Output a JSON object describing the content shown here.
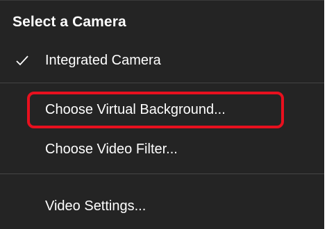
{
  "menu": {
    "header": "Select a Camera",
    "cameras": [
      {
        "label": "Integrated Camera",
        "selected": true
      }
    ],
    "actions": [
      {
        "label": "Choose Virtual Background..."
      },
      {
        "label": "Choose Video Filter..."
      }
    ],
    "settings": [
      {
        "label": "Video Settings..."
      }
    ]
  },
  "colors": {
    "menu_background": "#242424",
    "text": "#ffffff",
    "separator": "#454545",
    "highlight_outline": "#e8101e"
  },
  "icons": {
    "selected_check": "check-icon"
  }
}
